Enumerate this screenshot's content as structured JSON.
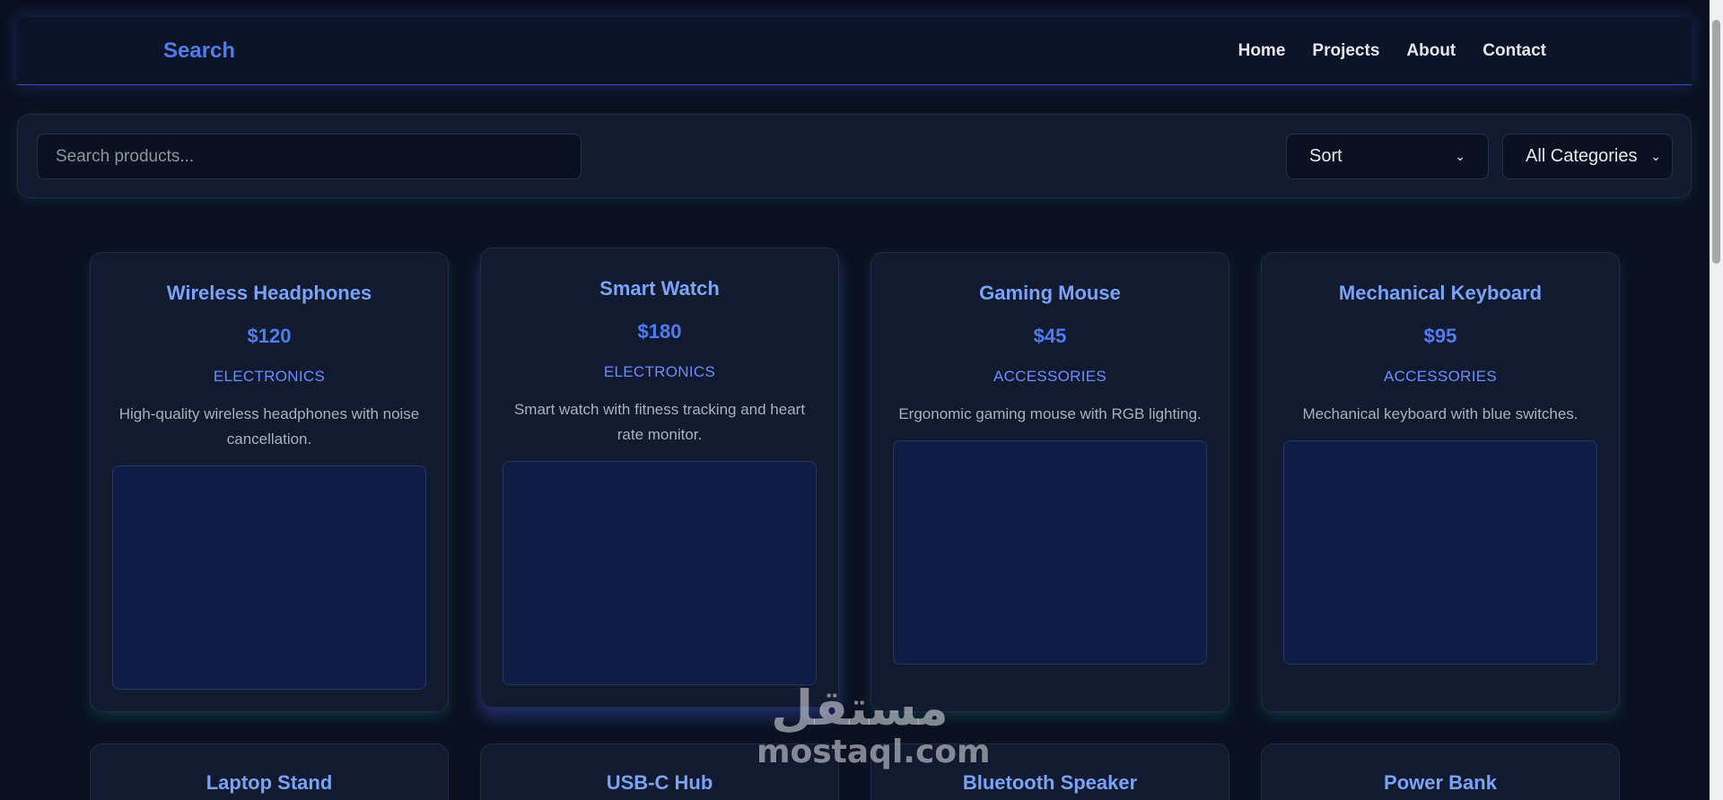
{
  "navbar": {
    "brand": "Search",
    "links": [
      "Home",
      "Projects",
      "About",
      "Contact"
    ]
  },
  "filters": {
    "search_placeholder": "Search products...",
    "sort_value": "Sort",
    "category_value": "All Categories"
  },
  "products": [
    {
      "title": "Wireless Headphones",
      "price": "$120",
      "category": "ELECTRONICS",
      "description": "High-quality wireless headphones with noise cancellation."
    },
    {
      "title": "Smart Watch",
      "price": "$180",
      "category": "ELECTRONICS",
      "description": "Smart watch with fitness tracking and heart rate monitor."
    },
    {
      "title": "Gaming Mouse",
      "price": "$45",
      "category": "ACCESSORIES",
      "description": "Ergonomic gaming mouse with RGB lighting."
    },
    {
      "title": "Mechanical Keyboard",
      "price": "$95",
      "category": "ACCESSORIES",
      "description": "Mechanical keyboard with blue switches."
    },
    {
      "title": "Laptop Stand"
    },
    {
      "title": "USB-C Hub"
    },
    {
      "title": "Bluetooth Speaker"
    },
    {
      "title": "Power Bank"
    }
  ],
  "watermark": {
    "arabic": "مستقل",
    "latin": "mostaql.com"
  },
  "colors": {
    "accent": "#4f7cf0",
    "title": "#7aa2f7",
    "background": "#0b1120",
    "card": "#111a2e"
  }
}
